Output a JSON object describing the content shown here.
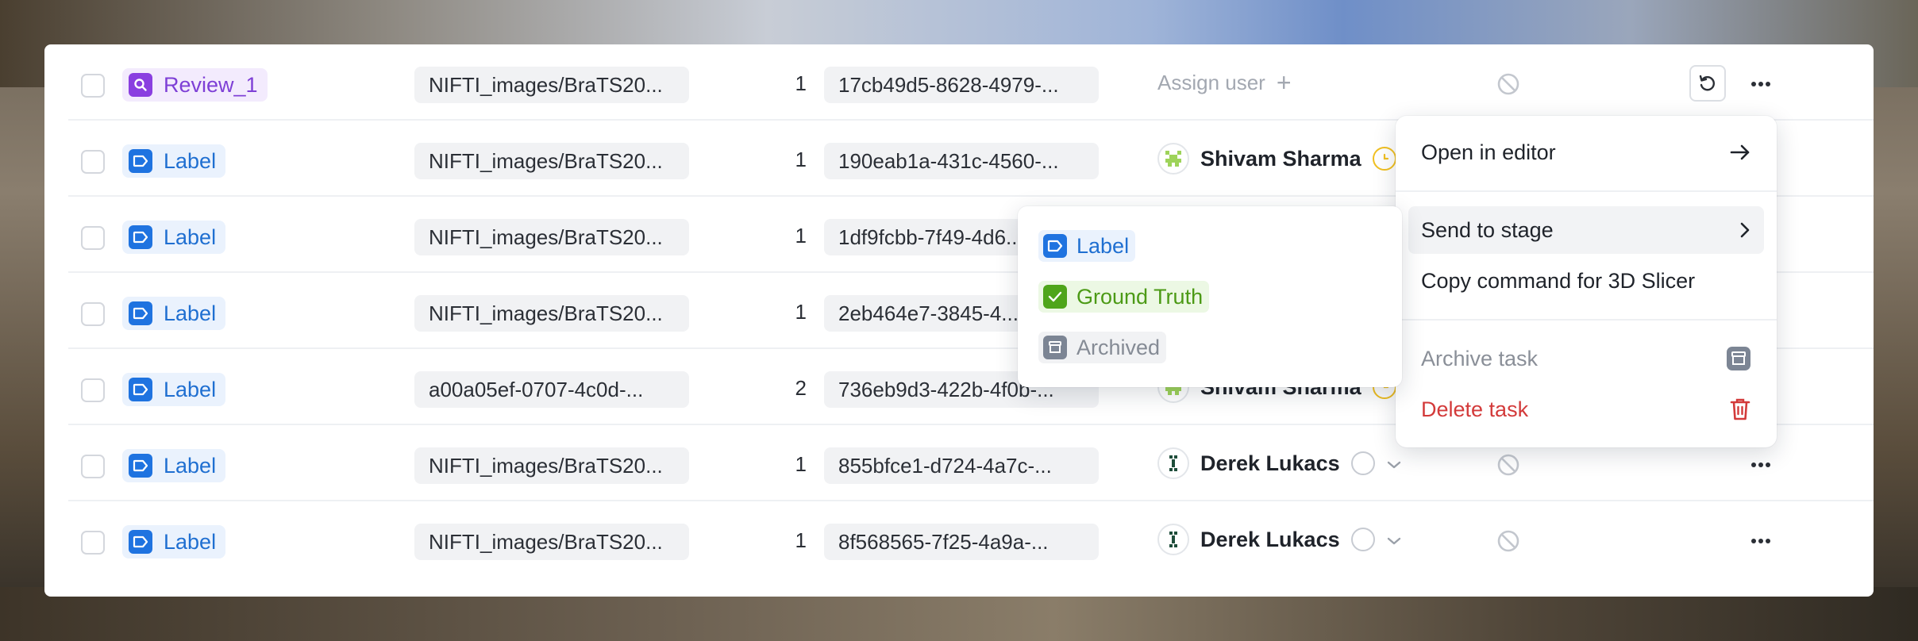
{
  "colors": {
    "label_stage": "#1f73e0",
    "review_stage": "#8a3fe0",
    "ground_truth_stage": "#4ea51a",
    "archived_stage": "#7c8594",
    "danger": "#d33a3a",
    "pending_status": "#f1c021"
  },
  "rows": [
    {
      "stage": "Review_1",
      "stage_type": "review",
      "file": "NIFTI_images/BraTS20...",
      "count": "1",
      "id": "17cb49d5-8628-4979-...",
      "assignee": null,
      "assign_label": "Assign user",
      "status": "none"
    },
    {
      "stage": "Label",
      "stage_type": "label",
      "file": "NIFTI_images/BraTS20...",
      "count": "1",
      "id": "190eab1a-431c-4560-...",
      "assignee": "Shivam Sharma",
      "status": "pending"
    },
    {
      "stage": "Label",
      "stage_type": "label",
      "file": "NIFTI_images/BraTS20...",
      "count": "1",
      "id": "1df9fcbb-7f49-4d6...",
      "assignee": null,
      "status": "none"
    },
    {
      "stage": "Label",
      "stage_type": "label",
      "file": "NIFTI_images/BraTS20...",
      "count": "1",
      "id": "2eb464e7-3845-4...",
      "assignee": null,
      "status": "none"
    },
    {
      "stage": "Label",
      "stage_type": "label",
      "file": "a00a05ef-0707-4c0d-...",
      "count": "2",
      "id": "736eb9d3-422b-4f0b-...",
      "assignee": "Shivam Sharma",
      "status": "pending"
    },
    {
      "stage": "Label",
      "stage_type": "label",
      "file": "NIFTI_images/BraTS20...",
      "count": "1",
      "id": "855bfce1-d724-4a7c-...",
      "assignee": "Derek Lukacs",
      "status": "empty"
    },
    {
      "stage": "Label",
      "stage_type": "label",
      "file": "NIFTI_images/BraTS20...",
      "count": "1",
      "id": "8f568565-7f25-4a9a-...",
      "assignee": "Derek Lukacs",
      "status": "empty"
    }
  ],
  "context_menu": {
    "open_in_editor": "Open in editor",
    "send_to_stage": "Send to stage",
    "copy_command": "Copy command for 3D Slicer",
    "archive_task": "Archive task",
    "delete_task": "Delete task"
  },
  "stage_submenu": {
    "label": "Label",
    "ground_truth": "Ground Truth",
    "archived": "Archived"
  }
}
